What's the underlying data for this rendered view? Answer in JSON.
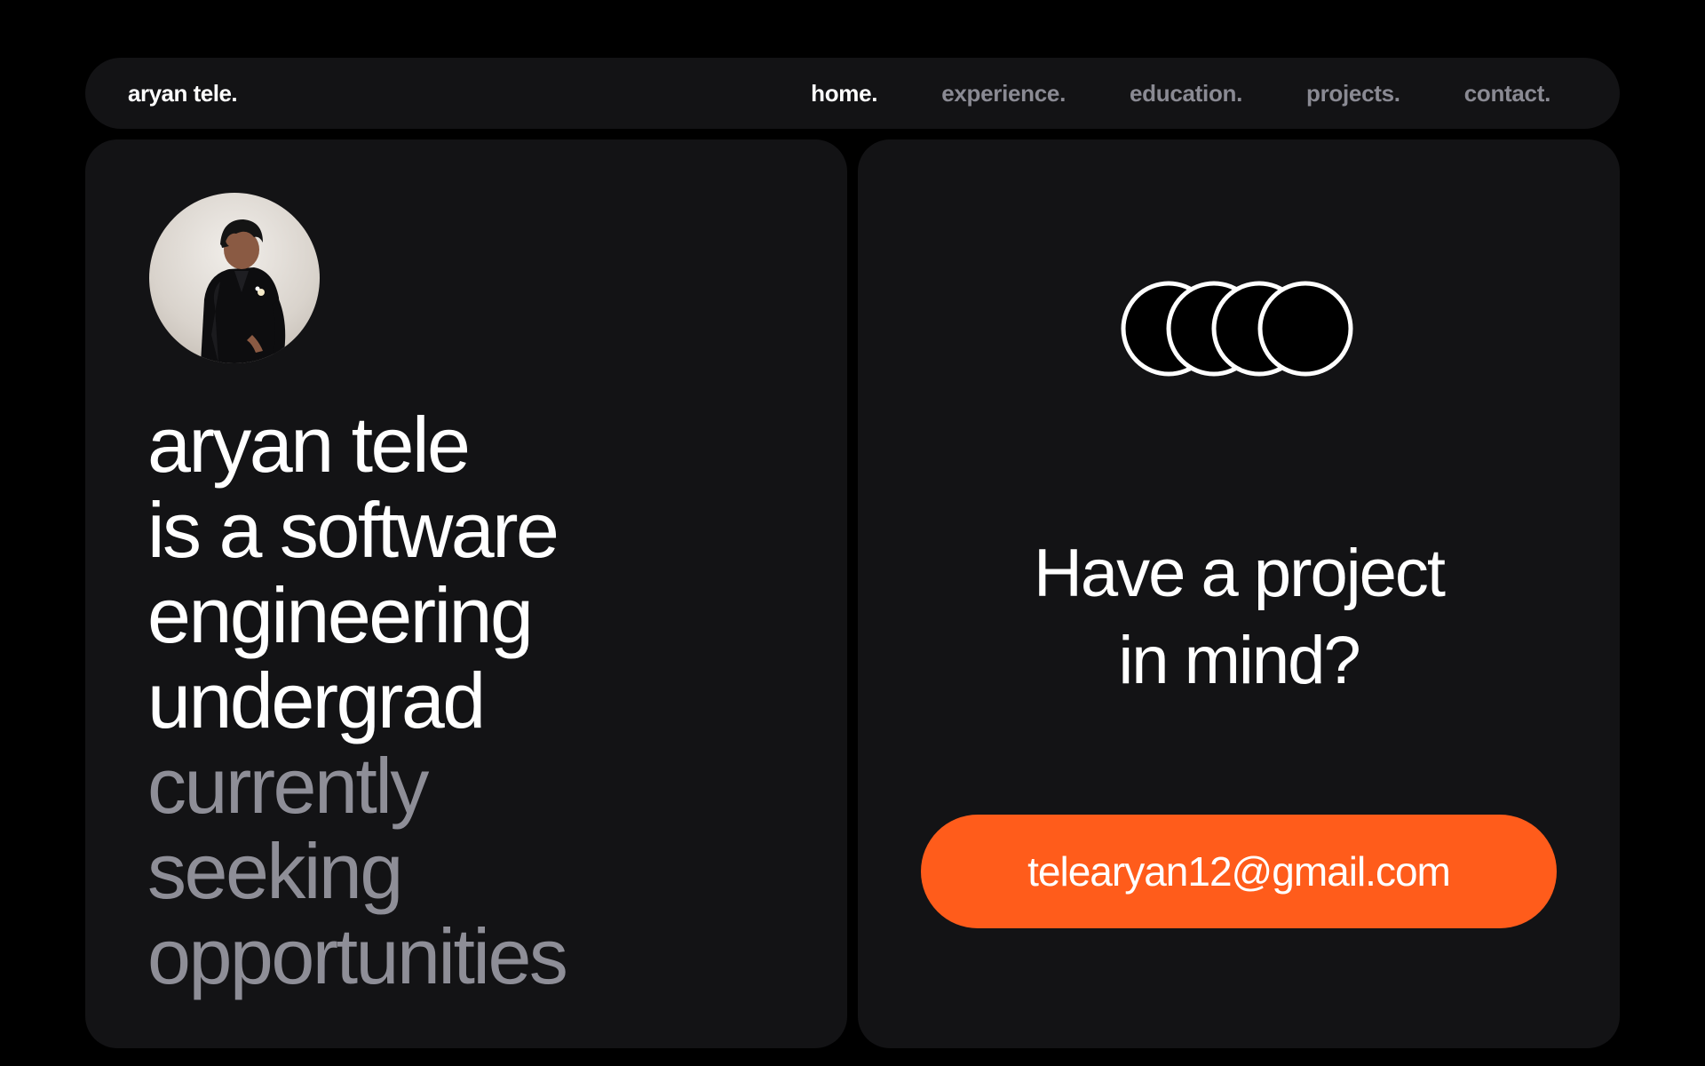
{
  "nav": {
    "brand": "aryan tele.",
    "links": [
      {
        "label": "home.",
        "active": true
      },
      {
        "label": "experience.",
        "active": false
      },
      {
        "label": "education.",
        "active": false
      },
      {
        "label": "projects.",
        "active": false
      },
      {
        "label": "contact.",
        "active": false
      }
    ]
  },
  "hero": {
    "avatar_icon": "profile-photo",
    "lines_primary": [
      "aryan tele",
      "is a software",
      "engineering",
      "undergrad"
    ],
    "lines_secondary": [
      "currently",
      "seeking",
      "opportunities"
    ]
  },
  "contact_card": {
    "logo_icon": "four-overlapping-circles-icon",
    "title_lines": [
      "Have a project",
      "in mind?"
    ],
    "email": "telearyan12@gmail.com"
  },
  "colors": {
    "background": "#000000",
    "card": "#131315",
    "text_primary": "#ffffff",
    "text_muted": "#8e8e97",
    "accent": "#ff5c1b"
  }
}
